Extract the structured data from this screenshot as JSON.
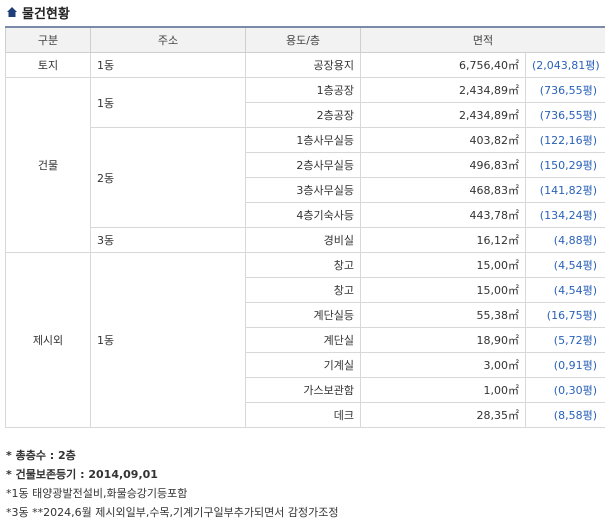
{
  "title": "물건현황",
  "headers": [
    "구분",
    "주소",
    "용도/층",
    "면적"
  ],
  "rows": [
    {
      "category": "토지",
      "address": "1동",
      "usage": "공장용지",
      "area": "6,756,40㎡",
      "pyeong": "(2,043,81평)"
    },
    {
      "category": "건물",
      "address": "1동",
      "usage": "1층공장",
      "area": "2,434,89㎡",
      "pyeong": "(736,55평)"
    },
    {
      "usage": "2층공장",
      "area": "2,434,89㎡",
      "pyeong": "(736,55평)"
    },
    {
      "address": "2동",
      "usage": "1층사무실등",
      "area": "403,82㎡",
      "pyeong": "(122,16평)"
    },
    {
      "usage": "2층사무실등",
      "area": "496,83㎡",
      "pyeong": "(150,29평)"
    },
    {
      "usage": "3층사무실등",
      "area": "468,83㎡",
      "pyeong": "(141,82평)"
    },
    {
      "usage": "4층기숙사등",
      "area": "443,78㎡",
      "pyeong": "(134,24평)"
    },
    {
      "address": "3동",
      "usage": "경비실",
      "area": "16,12㎡",
      "pyeong": "(4,88평)"
    },
    {
      "category": "제시외",
      "address": "1동",
      "usage": "창고",
      "area": "15,00㎡",
      "pyeong": "(4,54평)"
    },
    {
      "usage": "창고",
      "area": "15,00㎡",
      "pyeong": "(4,54평)"
    },
    {
      "usage": "계단실등",
      "area": "55,38㎡",
      "pyeong": "(16,75평)"
    },
    {
      "usage": "계단실",
      "area": "18,90㎡",
      "pyeong": "(5,72평)"
    },
    {
      "usage": "기계실",
      "area": "3,00㎡",
      "pyeong": "(0,91평)"
    },
    {
      "usage": "가스보관함",
      "area": "1,00㎡",
      "pyeong": "(0,30평)"
    },
    {
      "usage": "데크",
      "area": "28,35㎡",
      "pyeong": "(8,58평)"
    }
  ],
  "notes": [
    "* 총층수 : 2층",
    "* 건물보존등기 : 2014,09,01",
    "*1동 태양광발전설비,화물승강기등포함",
    "*3동 **2024,6월 제시외일부,수목,기계기구일부추가되면서 감정가조정"
  ],
  "colors": {
    "header_border": "#7a8aa8",
    "pyeong_text": "#2a62b8",
    "header_bg": "#f2f2f2"
  }
}
